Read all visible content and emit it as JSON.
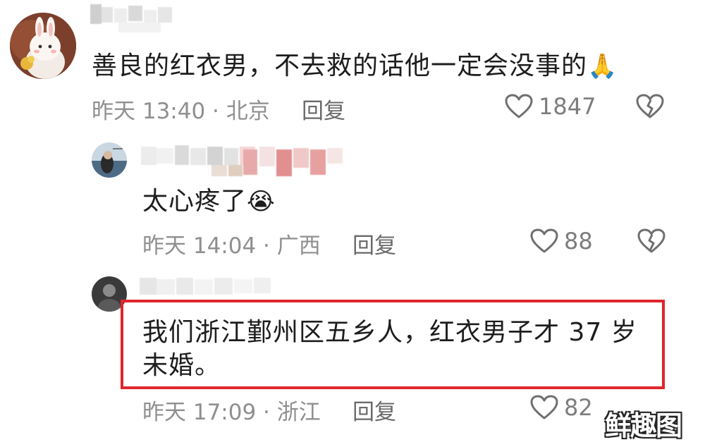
{
  "comments": [
    {
      "text": "善良的红衣男，不去救的话他一定会没事的",
      "emoji": "🙏",
      "emoji_name": "praying-hands",
      "time_location": "昨天 13:40 · 北京",
      "reply_label": "回复",
      "like_count": "1847"
    },
    {
      "text": "太心疼了",
      "emoji": "😭",
      "emoji_name": "crying-face",
      "time_location": "昨天 14:04 · 广西",
      "reply_label": "回复",
      "like_count": "88"
    },
    {
      "text_line1": "我们浙江鄞州区五乡人，红衣男子才 37 岁",
      "text_line2": "未婚。",
      "time_location": "昨天 17:09 · 浙江",
      "reply_label": "回复",
      "like_count": "82"
    }
  ],
  "watermark": "鲜趣图",
  "colors": {
    "highlight": "#e0262d",
    "meta_text": "#8f8f8f",
    "icon": "#6f6f6f"
  },
  "icons": [
    "heart-outline-icon",
    "broken-heart-icon"
  ]
}
